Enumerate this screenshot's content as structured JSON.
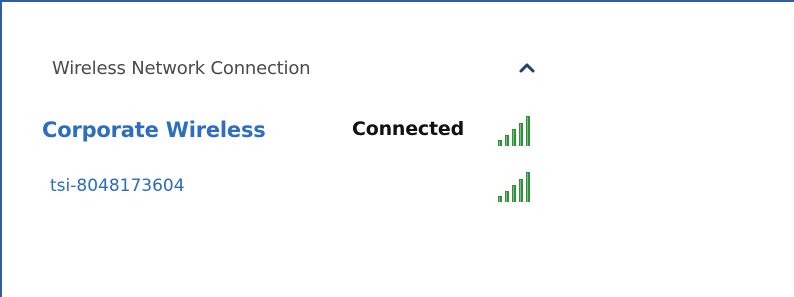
{
  "section": {
    "title": "Wireless Network Connection",
    "collapse_icon": "chevron-up-icon"
  },
  "networks": [
    {
      "name": "Corporate Wireless",
      "status": "Connected",
      "signal_icon": "signal-strength-icon",
      "signal_bars": 5
    },
    {
      "name": "tsi-8048173604",
      "status": "",
      "signal_icon": "signal-strength-icon",
      "signal_bars": 5
    }
  ],
  "colors": {
    "link": "#2a6cc0",
    "signal_green": "#2f8f3a",
    "border": "#2f5fa0",
    "chevron": "#1f3f70"
  }
}
